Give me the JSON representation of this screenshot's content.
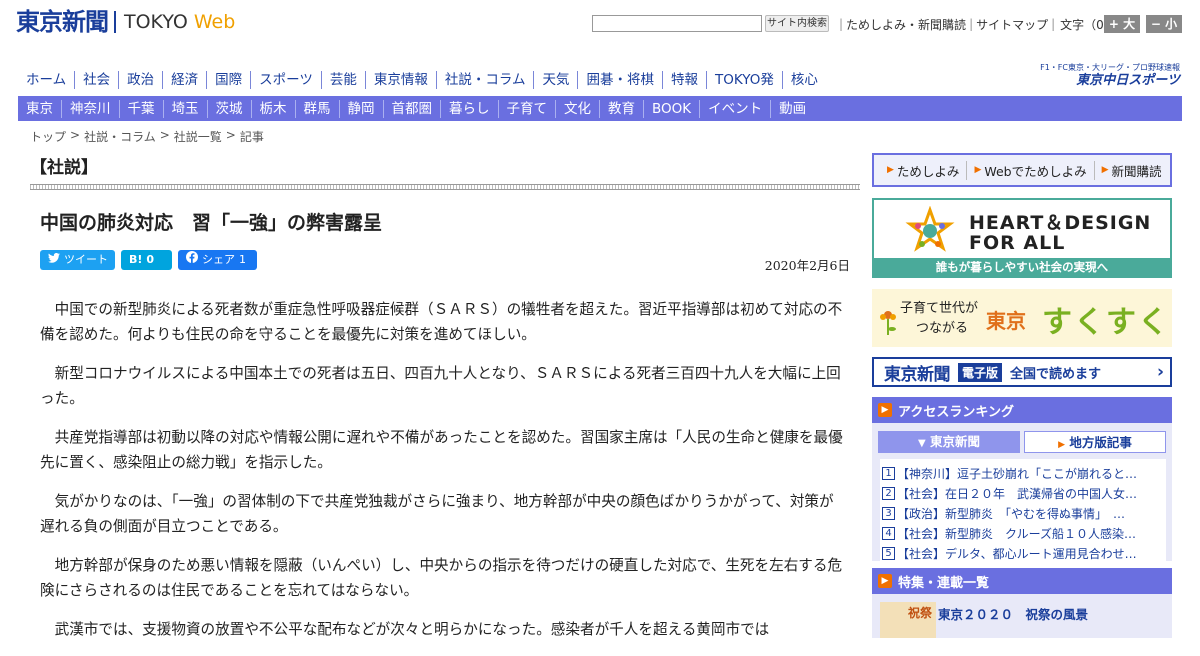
{
  "header": {
    "logo_jp": "東京新聞",
    "logo_tokyo": "TOKYO",
    "logo_web": "Web",
    "search_placeholder": "",
    "search_button": "サイト内検索",
    "util_links": [
      "ためしよみ・新聞購読",
      "サイトマップ"
    ],
    "fontsize_label": "文字（0）",
    "font_plus": "+ 大",
    "font_minus": "− 小"
  },
  "nav_main": [
    "ホーム",
    "社会",
    "政治",
    "経済",
    "国際",
    "スポーツ",
    "芸能",
    "東京情報",
    "社説・コラム",
    "天気",
    "囲碁・将棋",
    "特報",
    "TOKYO発",
    "核心"
  ],
  "chunichi": {
    "sub": "F1・FC東京・大リーグ・プロ野球速報",
    "name": "東京中日スポーツ"
  },
  "nav_sub": [
    "東京",
    "神奈川",
    "千葉",
    "埼玉",
    "茨城",
    "栃木",
    "群馬",
    "静岡",
    "首都圏",
    "暮らし",
    "子育て",
    "文化",
    "教育",
    "BOOK",
    "イベント",
    "動画"
  ],
  "breadcrumb": [
    "トップ",
    "社説・コラム",
    "社説一覧",
    "記事"
  ],
  "breadcrumb_sep": ">",
  "article": {
    "section": "【社説】",
    "title": "中国の肺炎対応　習「一強」の弊害露呈",
    "date": "2020年2月6日",
    "share": {
      "tweet": "ツイート",
      "hatena_label": "B!",
      "hatena_count": "0",
      "fb_label": "シェア",
      "fb_count": "1"
    },
    "paragraphs": [
      "中国での新型肺炎による死者数が重症急性呼吸器症候群（ＳＡＲＳ）の犠牲者を超えた。習近平指導部は初めて対応の不備を認めた。何よりも住民の命を守ることを最優先に対策を進めてほしい。",
      "新型コロナウイルスによる中国本土での死者は五日、四百九十人となり、ＳＡＲＳによる死者三百四十九人を大幅に上回った。",
      "共産党指導部は初動以降の対応や情報公開に遅れや不備があったことを認めた。習国家主席は「人民の生命と健康を最優先に置く、感染阻止の総力戦」を指示した。",
      "気がかりなのは、「一強」の習体制の下で共産党独裁がさらに強まり、地方幹部が中央の顔色ばかりうかがって、対策が遅れる負の側面が目立つことである。",
      "地方幹部が保身のため悪い情報を隠蔽（いんぺい）し、中央からの指示を待つだけの硬直した対応で、生死を左右する危険にさらされるのは住民であることを忘れてはならない。",
      "武漢市では、支援物資の放置や不公平な配布などが次々と明らかになった。感染者が千人を超える黄岡市では"
    ]
  },
  "right": {
    "quick_links": [
      "ためしよみ",
      "Webでためしよみ",
      "新聞購読"
    ],
    "hd_title1": "HEART＆DESIGN",
    "hd_title2": "FOR ALL",
    "hd_caption": "誰もが暮らしやすい社会の実現へ",
    "suku_sub1": "子育て世代が",
    "suku_sub2": "つながる",
    "suku_tokyo": "東京",
    "suku_name": "すくすく",
    "eban_logo": "東京新聞",
    "eban_tag": "電子版",
    "eban_text": "全国で読めます",
    "ranking_head": "アクセスランキング",
    "rank_tab_tokyo": "東京新聞",
    "rank_tab_local": "地方版記事",
    "ranking": [
      {
        "num": "1",
        "text": "【神奈川】逗子土砂崩れ「ここが崩れると…"
      },
      {
        "num": "2",
        "text": "【社会】在日２０年　武漢帰省の中国人女…"
      },
      {
        "num": "3",
        "text": "【政治】新型肺炎　「やむを得ぬ事情」　…"
      },
      {
        "num": "4",
        "text": "【社会】新型肺炎　クルーズ船１０人感染…"
      },
      {
        "num": "5",
        "text": "【社会】デルタ、都心ルート運用見合わせ…"
      }
    ],
    "features_head": "特集・連載一覧",
    "feature_thumb": "祝祭",
    "feature_title": "東京２０２０　祝祭の風景"
  },
  "colors": {
    "brand_blue": "#1a3e9b",
    "nav_bar": "#6a6fe0",
    "accent_orange": "#f07000",
    "hd_green": "#4aaa9a"
  }
}
